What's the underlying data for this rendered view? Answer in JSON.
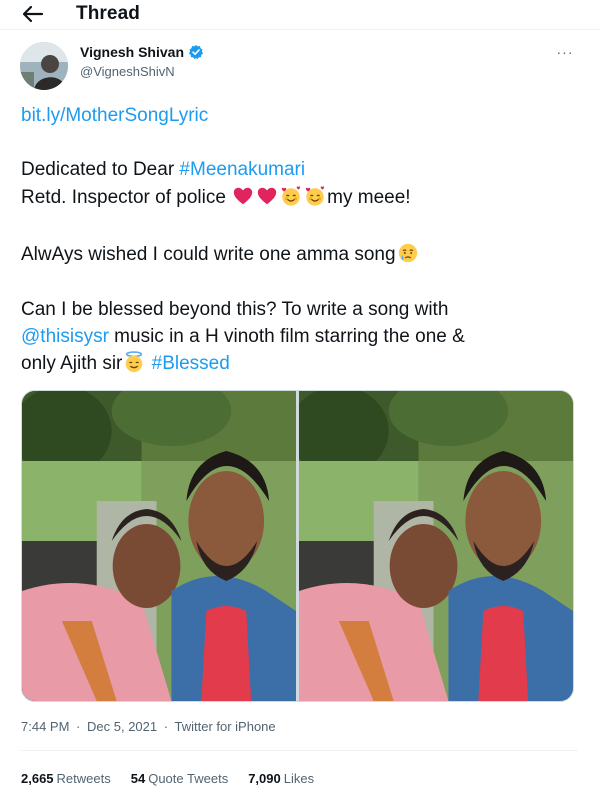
{
  "header": {
    "title": "Thread",
    "back_icon": "arrow-left-icon"
  },
  "author": {
    "display_name": "Vignesh Shivan",
    "handle": "@VigneshShivN",
    "verified_color": "#1d9bf0"
  },
  "more_icon_text": "···",
  "tweet": {
    "link": "bit.ly/MotherSongLyric",
    "line2_prefix": "Dedicated to Dear ",
    "line2_hashtag": "#Meenakumari",
    "line3_text": "Retd. Inspector of police ",
    "line3_suffix": "my meee!",
    "line4_text": "AlwAys wished I could write one amma song",
    "line5_text": "Can I be blessed beyond this? To write a song with",
    "line6_mention": "@thisisysr",
    "line6_text": " music in a H vinoth film starring the one &",
    "line7_text": "only Ajith sir",
    "line7_hashtag": "#Blessed"
  },
  "meta": {
    "time": "7:44 PM",
    "separator": "·",
    "date": "Dec 5, 2021",
    "source": "Twitter for iPhone"
  },
  "stats": {
    "retweets_count": "2,665",
    "retweets_label": "Retweets",
    "quotes_count": "54",
    "quotes_label": "Quote Tweets",
    "likes_count": "7,090",
    "likes_label": "Likes"
  },
  "colors": {
    "link": "#1d9bf0",
    "text": "#0f1419",
    "secondary": "#536471",
    "heart": "#e0245e"
  }
}
